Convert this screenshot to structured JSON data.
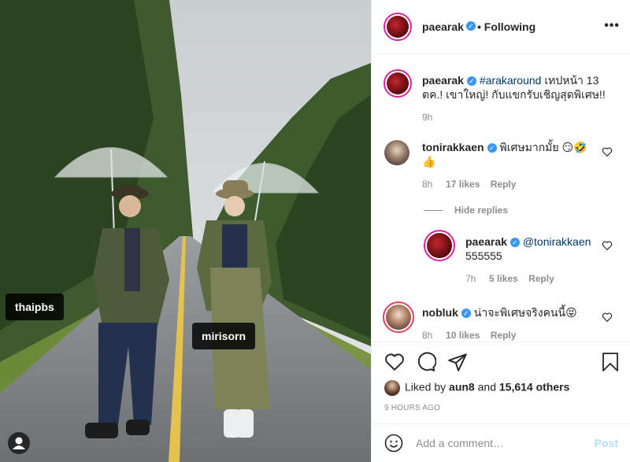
{
  "post": {
    "photo_tags": [
      "thaipbs",
      "mirisorn"
    ],
    "author": "paearak",
    "follow_status": "Following",
    "more_glyph": "•••"
  },
  "caption": {
    "username": "paearak",
    "hashtag": "#arakaround",
    "text": "เทปหน้า 13 ตค.! เขาใหญ่! กับแขกรับเชิญสุดพิเศษ!!",
    "time": "9h"
  },
  "comments": [
    {
      "username": "tonirakkaen",
      "text": "พิเศษมากมั้ย 😏🤣 👍",
      "time": "8h",
      "likes": "17 likes",
      "reply": "Reply",
      "hide_replies": "Hide replies"
    },
    {
      "username": "paearak",
      "mention": "@tonirakkaen",
      "text": "555555",
      "time": "7h",
      "likes": "5 likes",
      "reply": "Reply"
    },
    {
      "username": "nobluk",
      "text": "น่าจะพิเศษจริงคนนี้😝",
      "time": "8h",
      "likes": "10 likes",
      "reply": "Reply"
    }
  ],
  "likes_summary": {
    "prefix": "Liked by",
    "user": "aun8",
    "joiner": "and",
    "others": "15,614 others"
  },
  "posted_ago": "9 HOURS AGO",
  "add_comment": {
    "placeholder": "Add a comment…",
    "post_label": "Post"
  },
  "colors": {
    "link": "#00376b",
    "verified": "#3897f0",
    "muted": "#8e8e8e",
    "post_disabled": "#b2dffc"
  }
}
